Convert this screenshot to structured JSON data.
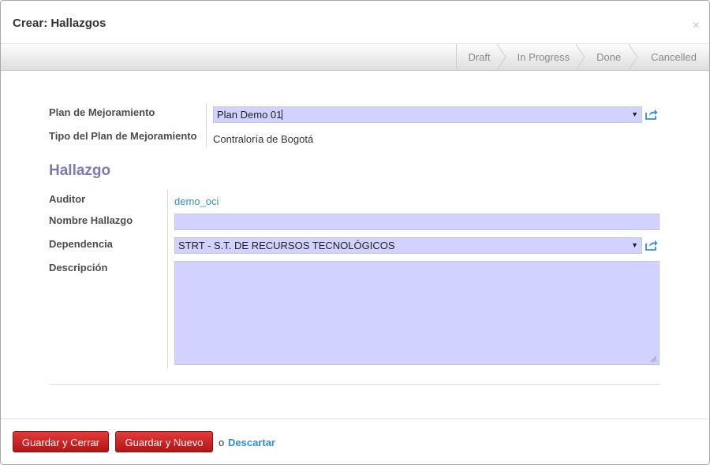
{
  "dialog": {
    "title": "Crear: Hallazgos",
    "close_glyph": "×"
  },
  "statusbar": {
    "states": [
      "Draft",
      "In Progress",
      "Done",
      "Cancelled"
    ]
  },
  "form": {
    "plan_label": "Plan de Mejoramiento",
    "plan_value": "Plan Demo 01",
    "tipo_label": "Tipo del Plan de Mejoramiento",
    "tipo_value": "Contraloría de Bogotá",
    "section_title": "Hallazgo",
    "auditor_label": "Auditor",
    "auditor_value": "demo_oci",
    "nombre_label": "Nombre Hallazgo",
    "nombre_value": "",
    "dependencia_label": "Dependencia",
    "dependencia_value": "STRT - S.T. DE RECURSOS TECNOLÓGICOS",
    "descripcion_label": "Descripción",
    "descripcion_value": ""
  },
  "footer": {
    "save_close": "Guardar y Cerrar",
    "save_new": "Guardar y Nuevo",
    "or": "o",
    "discard": "Descartar"
  },
  "colors": {
    "field_bg": "#d2d2ff",
    "button_red": "#c12222",
    "link_blue": "#2f8fd4",
    "section_purple": "#7c7bad"
  },
  "icons": {
    "select_caret": "triangle-down",
    "external": "external-link-icon",
    "resize": "resize-grip-icon"
  }
}
